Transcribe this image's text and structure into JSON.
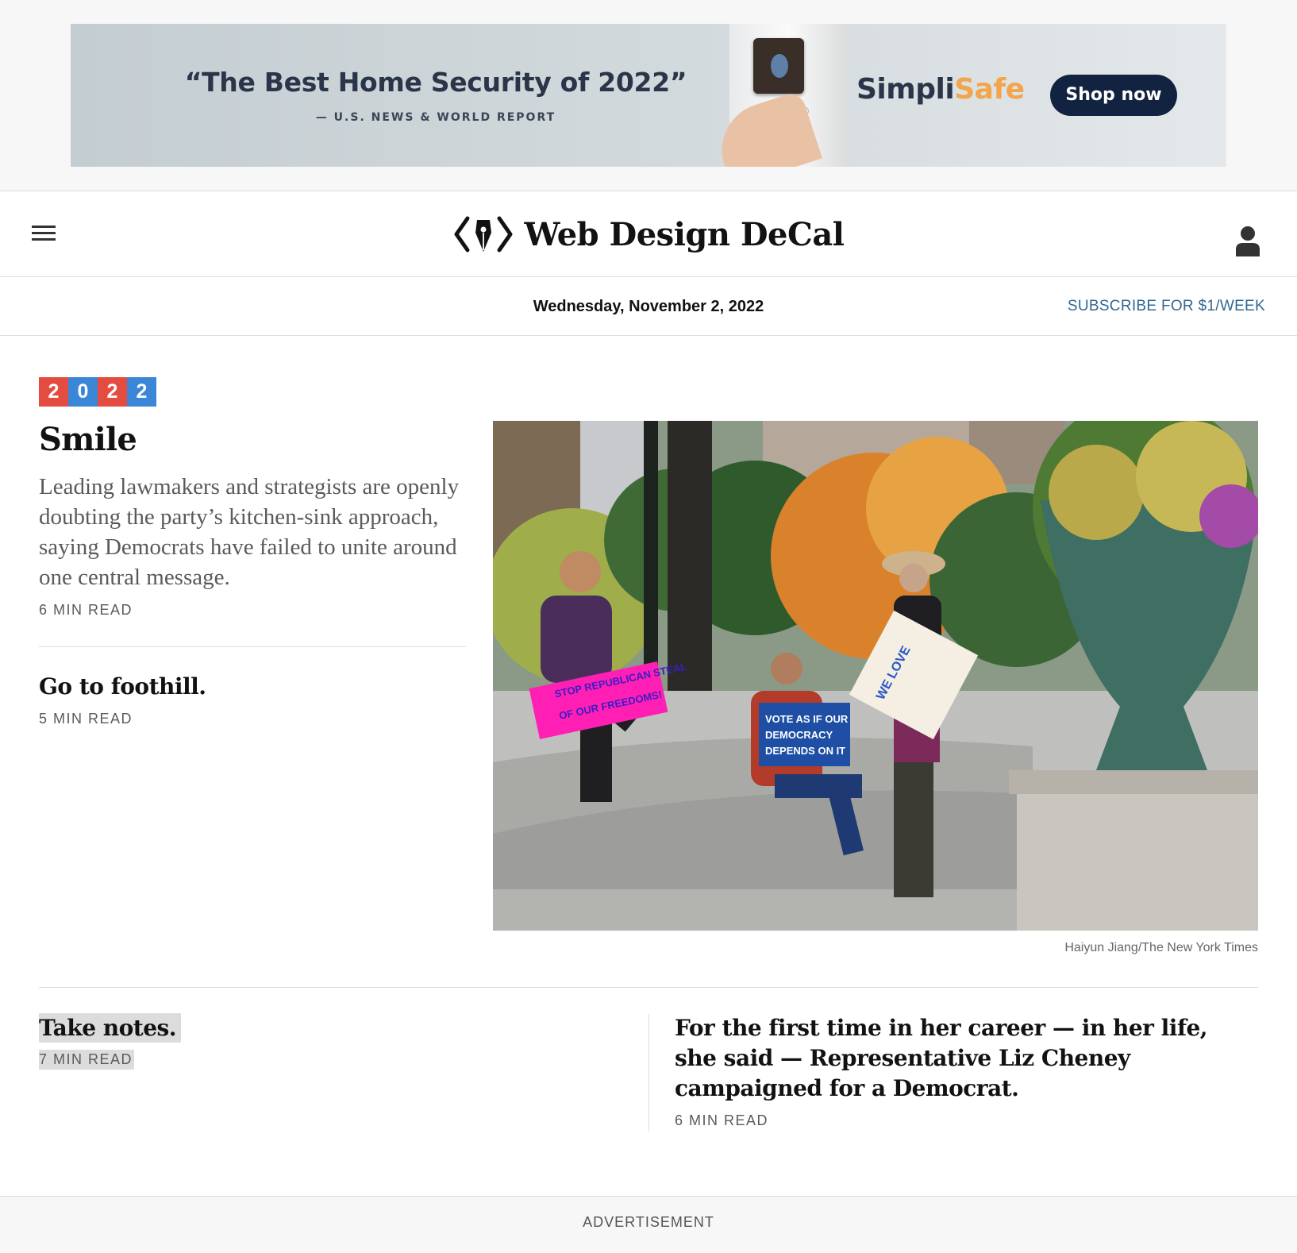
{
  "ad_top": {
    "quote": "“The Best Home Security of 2022”",
    "source": "— U.S. NEWS & WORLD REPORT",
    "brand_part1": "Simpli",
    "brand_part2": "Safe",
    "cta": "Shop now",
    "accent_color": "#f2a54a",
    "cta_color": "#112340"
  },
  "masthead": {
    "menu_icon": "hamburger-menu-icon",
    "logo_icon": "pen-nib-brackets-logo",
    "title": "Web Design DeCal",
    "user_icon": "user-account-icon"
  },
  "datebar": {
    "date": "Wednesday, November 2, 2022",
    "subscribe": "SUBSCRIBE FOR $1/WEEK",
    "subscribe_color": "#326891"
  },
  "main_story": {
    "badge_digits": [
      "2",
      "0",
      "2",
      "2"
    ],
    "badge_colors": [
      "#e44c42",
      "#3b86d6"
    ],
    "headline": "Smile",
    "summary": "Leading lawmakers and strategists are openly doubting the party’s kitchen-sink approach, saying Democrats have failed to unite around one central message.",
    "read_time": "6 MIN READ",
    "photo_credit": "Haiyun Jiang/The New York Times",
    "photo_signs": {
      "pink": [
        "STOP",
        "REPUBLICAN",
        "STEAL",
        "OF",
        "OUR FREEDOMS!"
      ],
      "blue": [
        "VOTE AS IF",
        "OUR",
        "DEMOCRACY",
        "DEPENDS ON IT"
      ]
    }
  },
  "secondary_story": {
    "headline": "Go to foothill.",
    "read_time": "5 MIN READ"
  },
  "bottom_stories": [
    {
      "headline": "Take notes.",
      "read_time": "7 MIN READ"
    },
    {
      "headline": "For the first time in her career — in her life, she said — Representative Liz Cheney campaigned for a Democrat.",
      "read_time": "6 MIN READ"
    }
  ],
  "ad_bottom": {
    "label": "ADVERTISEMENT"
  }
}
